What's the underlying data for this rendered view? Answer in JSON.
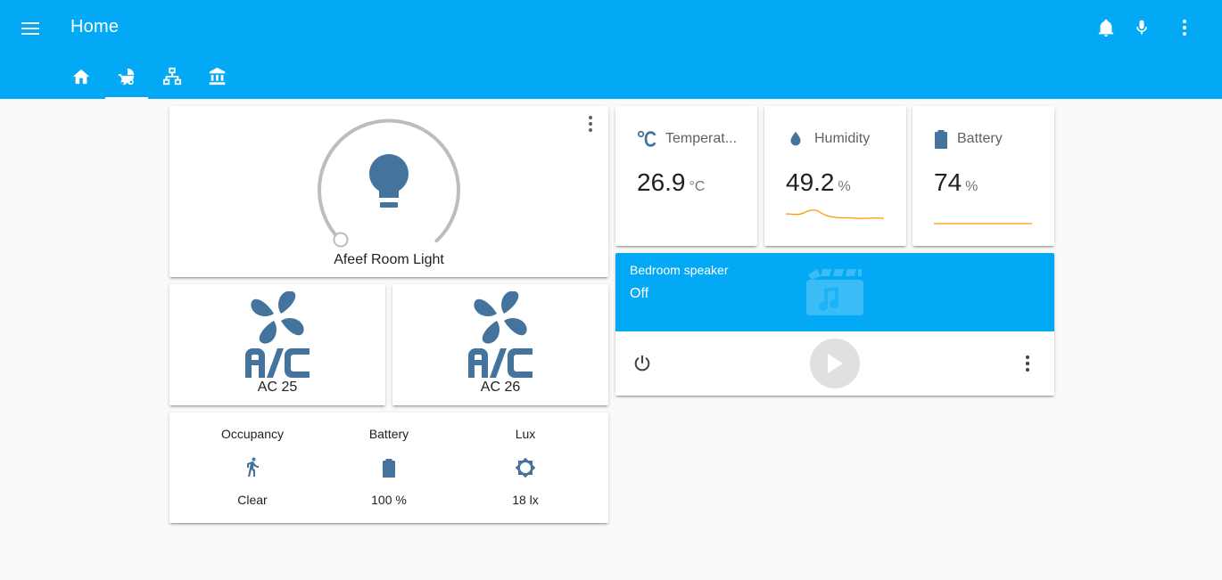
{
  "header": {
    "title": "Home",
    "icons": [
      "menu-icon",
      "bell-icon",
      "microphone-icon",
      "more-vertical-icon"
    ]
  },
  "tabs": [
    {
      "icon": "home-icon",
      "active": false
    },
    {
      "icon": "baby-carriage-icon",
      "active": true
    },
    {
      "icon": "network-icon",
      "active": false
    },
    {
      "icon": "bank-icon",
      "active": false
    }
  ],
  "light": {
    "name": "Afeef Room Light",
    "icon": "lightbulb-icon",
    "brightness": 0
  },
  "ac_entities": [
    {
      "name": "AC 25",
      "icon": "air-conditioner-icon"
    },
    {
      "name": "AC 26",
      "icon": "air-conditioner-icon"
    }
  ],
  "glance": [
    {
      "label": "Occupancy",
      "state": "Clear",
      "icon": "walk-icon"
    },
    {
      "label": "Battery",
      "state": "100 %",
      "icon": "battery-icon"
    },
    {
      "label": "Lux",
      "state": "18 lx",
      "icon": "brightness-icon"
    }
  ],
  "sensors": [
    {
      "name": "Temperat...",
      "value": "26.9",
      "unit": "°C",
      "icon": "celsius-icon"
    },
    {
      "name": "Humidity",
      "value": "49.2",
      "unit": "%",
      "icon": "water-drop-icon"
    },
    {
      "name": "Battery",
      "value": "74",
      "unit": "%",
      "icon": "battery-icon"
    }
  ],
  "media": {
    "name": "Bedroom speaker",
    "state": "Off",
    "art_icon": "music-video-icon"
  },
  "colors": {
    "primary": "#03a9f4",
    "icon": "#44739e",
    "graph": "#ff9800"
  }
}
